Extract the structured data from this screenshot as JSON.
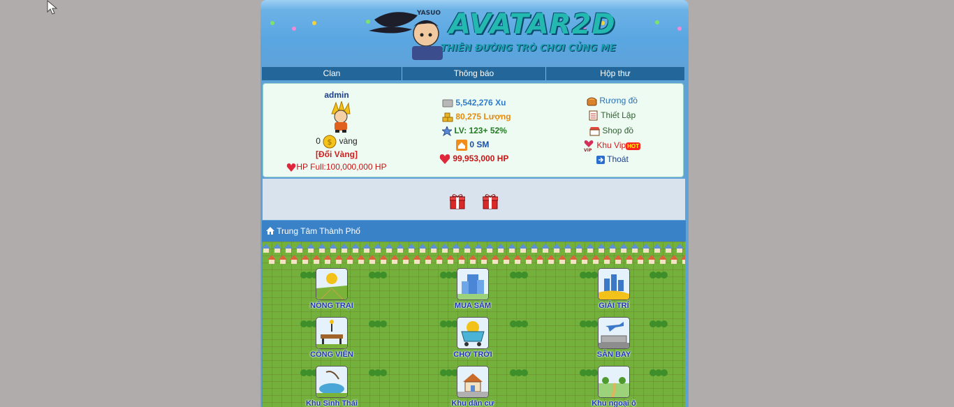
{
  "header": {
    "logo_text": "AVATAR2D",
    "logo_tagline": "THIÊN ĐƯỜNG TRÒ CHƠI CỦNG ME",
    "logo_tag": "YASUO"
  },
  "nav": {
    "items": [
      "Clan",
      "Thông báo",
      "Hộp thư"
    ]
  },
  "profile": {
    "username": "admin",
    "gold_amount": "0",
    "gold_unit": "vàng",
    "exchange_label": "[Đổi Vàng]",
    "hp_full": "HP Full:100,000,000 HP"
  },
  "stats": {
    "xu": "5,542,276 Xu",
    "luong": "80,275 Lượng",
    "level": "LV: 123+ 52%",
    "sm": "0 SM",
    "hp": "99,953,000 HP"
  },
  "menu": {
    "chest": "Rương đồ",
    "settings": "Thiết Lập",
    "shop": "Shop đồ",
    "vip": "Khu Vip",
    "vip_badge": "HOT",
    "logout": "Thoát"
  },
  "section": {
    "title": "Trung Tâm Thành Phố"
  },
  "locations": [
    {
      "name": "NÔNG TRẠI",
      "icon": "farm-icon"
    },
    {
      "name": "MUA SẮM",
      "icon": "shopping-icon"
    },
    {
      "name": "GIẢI TRÍ",
      "icon": "entertainment-icon"
    },
    {
      "name": "CÔNG VIÊN",
      "icon": "park-icon"
    },
    {
      "name": "CHỢ TRỜI",
      "icon": "market-icon"
    },
    {
      "name": "SÂN BAY",
      "icon": "airport-icon"
    },
    {
      "name": "Khu Sinh Thái",
      "icon": "eco-zone-icon"
    },
    {
      "name": "Khu dân cư",
      "icon": "residential-icon"
    },
    {
      "name": "Khu ngoại ô",
      "icon": "suburb-icon"
    }
  ],
  "colors": {
    "background": "#b0acab",
    "frame": "#5fa2d8",
    "nav": "#23679a",
    "section_bar": "#3a82c8",
    "info_box": "#eefbf3",
    "location_label": "#1a35b8"
  }
}
